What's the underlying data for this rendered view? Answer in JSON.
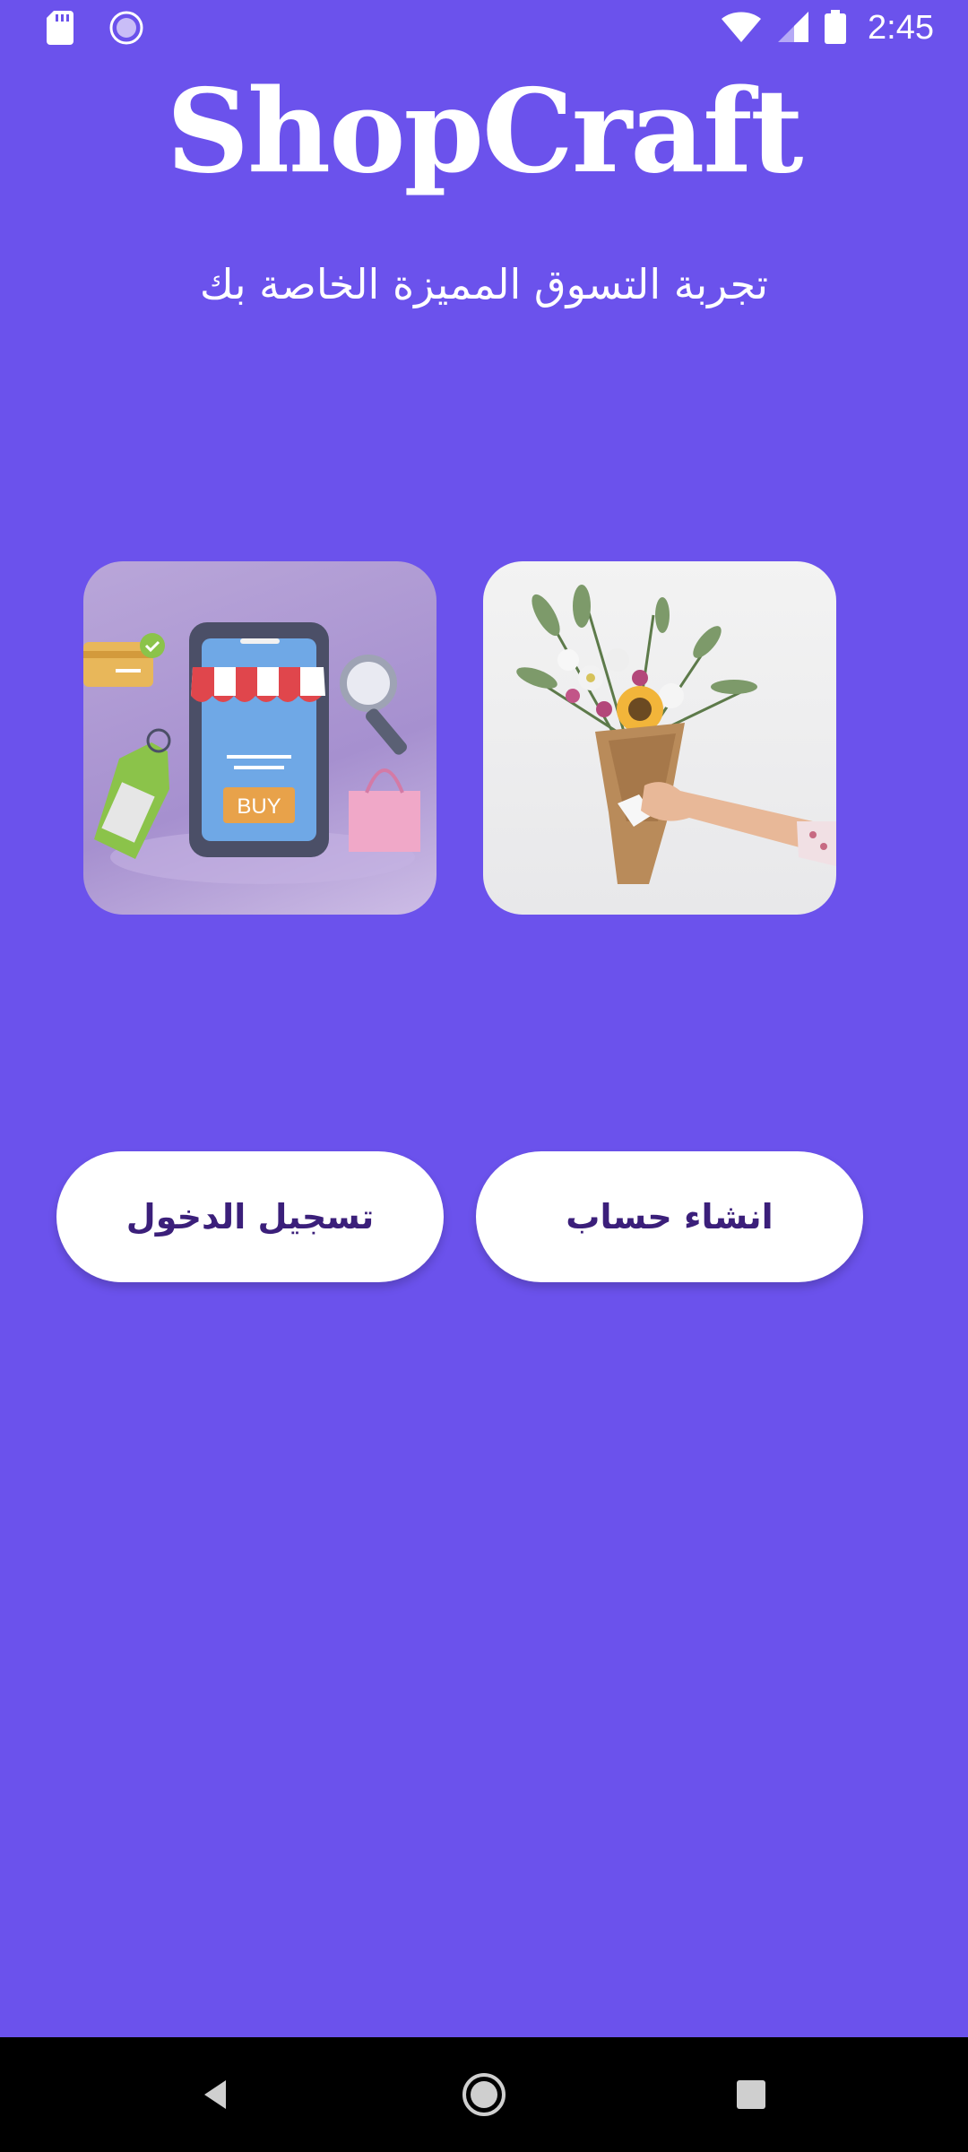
{
  "theme": {
    "background": "#6B52EC",
    "button_text": "#3B1F7A",
    "button_bg": "#FFFFFF"
  },
  "status_bar": {
    "time": "2:45",
    "left_icons": [
      "sd-card-icon",
      "sync-icon"
    ],
    "right_icons": [
      "wifi-icon",
      "signal-icon",
      "battery-icon"
    ]
  },
  "header": {
    "app_name": "ShopCraft",
    "tagline": "تجربة التسوق المميزة الخاصة بك"
  },
  "hero_images": [
    {
      "name": "shopping-illustration",
      "label": "BUY"
    },
    {
      "name": "flower-bouquet-photo"
    }
  ],
  "actions": {
    "login_label": "تسجيل الدخول",
    "register_label": "انشاء حساب"
  },
  "nav_bar": {
    "icons": [
      "back-icon",
      "home-icon",
      "recents-icon"
    ]
  }
}
